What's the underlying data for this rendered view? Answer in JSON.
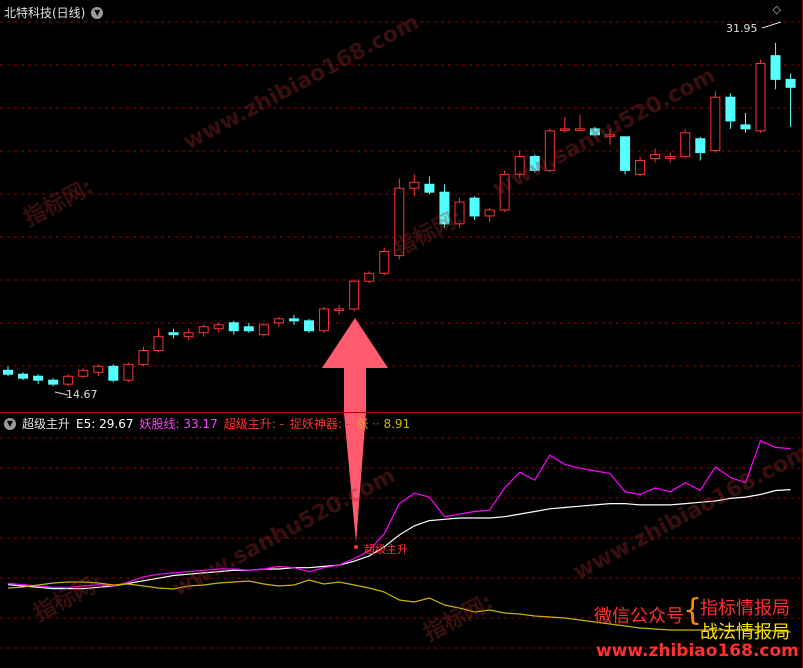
{
  "main": {
    "title": "北特科技(日线)",
    "high_label": "31.95",
    "low_label": "14.67"
  },
  "indicator": {
    "name": "超级主升",
    "e5_label": "E5:",
    "e5_value": "29.67",
    "yao_label": "妖股线:",
    "yao_value": "33.17",
    "super_label": "超级主升:",
    "super_value": "-",
    "catch_label": "捉妖神器:",
    "catch_value": "-",
    "zhang_label": "涨",
    "zhang_value": "8.91",
    "signal_text": "超级主升"
  },
  "promo": {
    "wechat": "微信公众号",
    "line1": "指标情报局",
    "line2": "战法情报局"
  },
  "watermarks": [
    "www.zhibiao168.com",
    "指标网:",
    "www.sanhu520.com"
  ],
  "colors": {
    "up": "#ff3232",
    "down": "#54ffff",
    "e5": "#ffffff",
    "yao": "#ff00ff",
    "zhang": "#c8b400",
    "grid": "#8b0000",
    "arrow": "#ff5a6e"
  },
  "chart_data": {
    "type": "candlestick",
    "ylim": [
      14.0,
      33.0
    ],
    "candles": [
      [
        15.4,
        15.6,
        15.1,
        15.2
      ],
      [
        15.2,
        15.3,
        14.9,
        15.0
      ],
      [
        15.1,
        15.2,
        14.7,
        14.9
      ],
      [
        14.9,
        15.0,
        14.6,
        14.7
      ],
      [
        14.7,
        15.2,
        14.6,
        15.1
      ],
      [
        15.1,
        15.5,
        15.0,
        15.4
      ],
      [
        15.3,
        15.7,
        15.1,
        15.6
      ],
      [
        15.6,
        15.7,
        14.8,
        14.9
      ],
      [
        14.9,
        15.8,
        14.8,
        15.7
      ],
      [
        15.7,
        16.6,
        15.6,
        16.4
      ],
      [
        16.4,
        17.5,
        16.3,
        17.1
      ],
      [
        17.3,
        17.5,
        17.0,
        17.2
      ],
      [
        17.1,
        17.5,
        16.9,
        17.3
      ],
      [
        17.3,
        17.7,
        17.1,
        17.6
      ],
      [
        17.5,
        17.8,
        17.3,
        17.7
      ],
      [
        17.8,
        17.9,
        17.2,
        17.4
      ],
      [
        17.6,
        17.8,
        17.3,
        17.4
      ],
      [
        17.2,
        17.8,
        17.1,
        17.7
      ],
      [
        17.8,
        18.1,
        17.6,
        18.0
      ],
      [
        18.0,
        18.2,
        17.7,
        17.9
      ],
      [
        17.9,
        18.0,
        17.3,
        17.4
      ],
      [
        17.4,
        18.6,
        17.3,
        18.5
      ],
      [
        18.5,
        18.7,
        18.2,
        18.5
      ],
      [
        18.5,
        20.0,
        18.4,
        19.9
      ],
      [
        19.9,
        20.4,
        19.8,
        20.3
      ],
      [
        20.3,
        21.6,
        20.2,
        21.4
      ],
      [
        21.2,
        25.1,
        21.0,
        24.6
      ],
      [
        24.6,
        25.3,
        24.2,
        24.9
      ],
      [
        24.8,
        25.2,
        24.3,
        24.4
      ],
      [
        24.4,
        24.8,
        22.6,
        22.8
      ],
      [
        22.8,
        24.1,
        22.6,
        23.9
      ],
      [
        24.1,
        24.2,
        23.0,
        23.2
      ],
      [
        23.2,
        23.6,
        22.9,
        23.5
      ],
      [
        23.5,
        25.5,
        23.4,
        25.3
      ],
      [
        25.3,
        26.5,
        25.1,
        26.2
      ],
      [
        26.2,
        26.3,
        25.4,
        25.5
      ],
      [
        25.5,
        27.6,
        25.4,
        27.5
      ],
      [
        27.6,
        28.2,
        27.4,
        27.6
      ],
      [
        27.6,
        28.3,
        27.5,
        27.6
      ],
      [
        27.6,
        27.7,
        27.2,
        27.3
      ],
      [
        27.3,
        27.6,
        26.8,
        27.3
      ],
      [
        27.2,
        26.4,
        25.3,
        25.5
      ],
      [
        25.3,
        26.2,
        25.2,
        26.0
      ],
      [
        26.1,
        26.6,
        25.9,
        26.3
      ],
      [
        26.1,
        26.4,
        25.9,
        26.2
      ],
      [
        26.2,
        27.6,
        26.1,
        27.4
      ],
      [
        27.1,
        27.2,
        26.0,
        26.4
      ],
      [
        26.5,
        29.5,
        26.4,
        29.2
      ],
      [
        29.2,
        29.4,
        27.6,
        28.0
      ],
      [
        27.8,
        28.4,
        27.4,
        27.6
      ],
      [
        27.5,
        31.1,
        27.4,
        30.9
      ],
      [
        31.3,
        31.95,
        29.6,
        30.1
      ],
      [
        30.1,
        30.4,
        27.7,
        29.7
      ]
    ],
    "e5": [
      22.4,
      22.3,
      22.2,
      22.1,
      22.1,
      22.1,
      22.2,
      22.3,
      22.5,
      22.7,
      22.9,
      23.1,
      23.2,
      23.3,
      23.4,
      23.5,
      23.5,
      23.6,
      23.6,
      23.7,
      23.7,
      23.8,
      23.9,
      24.2,
      24.6,
      25.3,
      26.2,
      26.9,
      27.3,
      27.4,
      27.5,
      27.5,
      27.5,
      27.6,
      27.8,
      28.0,
      28.2,
      28.3,
      28.4,
      28.5,
      28.6,
      28.6,
      28.5,
      28.5,
      28.5,
      28.6,
      28.7,
      28.8,
      29.0,
      29.1,
      29.3,
      29.6,
      29.67
    ],
    "yao": [
      22.5,
      22.4,
      22.3,
      22.2,
      22.2,
      22.3,
      22.4,
      22.3,
      22.6,
      23.0,
      23.2,
      23.3,
      23.4,
      23.5,
      23.6,
      23.6,
      23.5,
      23.6,
      23.8,
      23.7,
      23.4,
      23.7,
      23.9,
      24.4,
      25.0,
      26.3,
      28.6,
      29.4,
      29.1,
      27.6,
      27.8,
      28.0,
      28.1,
      29.8,
      31.0,
      30.4,
      32.3,
      31.6,
      31.3,
      31.1,
      30.9,
      29.5,
      29.3,
      29.8,
      29.5,
      30.2,
      29.6,
      31.4,
      30.6,
      30.2,
      33.4,
      32.9,
      32.8
    ],
    "zhang_y": [
      588,
      587,
      585,
      583,
      582,
      582,
      583,
      585,
      584,
      586,
      588,
      589,
      586,
      585,
      583,
      582,
      581,
      584,
      586,
      585,
      580,
      584,
      582,
      585,
      588,
      592,
      600,
      602,
      598,
      605,
      608,
      612,
      610,
      613,
      614,
      616,
      617,
      618,
      620,
      622,
      624,
      626,
      628,
      629,
      630,
      630,
      630,
      630,
      630,
      630,
      630,
      631,
      632
    ]
  }
}
